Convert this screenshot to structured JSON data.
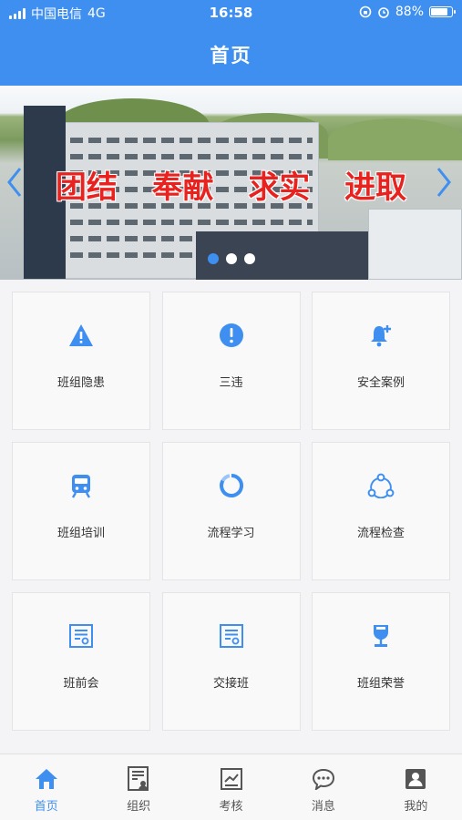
{
  "status_bar": {
    "carrier": "中国电信",
    "network": "4G",
    "time": "16:58",
    "battery": "88%",
    "battery_level": 0.88
  },
  "header": {
    "title": "首页"
  },
  "banner": {
    "slogan": [
      "团结",
      "奉献",
      "求实",
      "进取"
    ],
    "slide_count": 3,
    "active_slide": 0
  },
  "grid": {
    "items": [
      {
        "label": "班组隐患",
        "icon": "warning-icon"
      },
      {
        "label": "三违",
        "icon": "exclamation-circle-icon"
      },
      {
        "label": "安全案例",
        "icon": "bell-plus-icon"
      },
      {
        "label": "班组培训",
        "icon": "train-icon"
      },
      {
        "label": "流程学习",
        "icon": "loading-circle-icon"
      },
      {
        "label": "流程检查",
        "icon": "share-nodes-icon"
      },
      {
        "label": "班前会",
        "icon": "document-icon"
      },
      {
        "label": "交接班",
        "icon": "document-icon"
      },
      {
        "label": "班组荣誉",
        "icon": "trophy-cup-icon"
      }
    ]
  },
  "tab_bar": {
    "tabs": [
      {
        "label": "首页",
        "icon": "home-icon",
        "active": true
      },
      {
        "label": "组织",
        "icon": "organization-icon",
        "active": false
      },
      {
        "label": "考核",
        "icon": "chart-icon",
        "active": false
      },
      {
        "label": "消息",
        "icon": "message-icon",
        "active": false
      },
      {
        "label": "我的",
        "icon": "profile-icon",
        "active": false
      }
    ]
  },
  "colors": {
    "accent": "#3f8ff0",
    "icon": "#3f8ff0",
    "slogan": "#e8221f"
  }
}
